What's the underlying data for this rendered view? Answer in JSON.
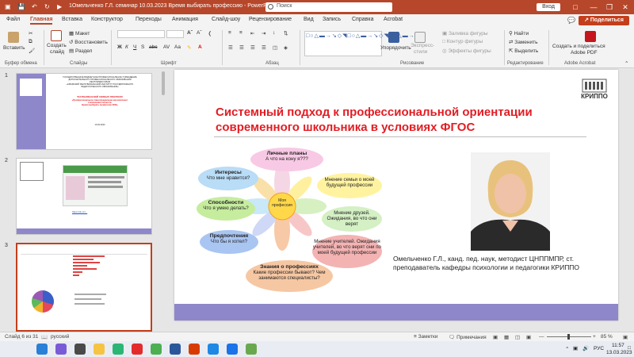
{
  "titlebar": {
    "doc_title": "1Омельченко Г.Л. семинар 10.03.2023 Время выбирать профессию  -  PowerPoint",
    "search": "Поиск",
    "signin": "Вход"
  },
  "tabs": [
    "Файл",
    "Главная",
    "Вставка",
    "Конструктор",
    "Переходы",
    "Анимация",
    "Слайд-шоу",
    "Рецензирование",
    "Вид",
    "Запись",
    "Справка",
    "Acrobat"
  ],
  "share": "Поделиться",
  "ribbon": {
    "paste": "Вставить",
    "create_slide_line1": "Создать",
    "create_slide_line2": "слайд",
    "layout": "Макет",
    "reset": "Восстановить",
    "section": "Раздел",
    "shape_fill": "Заливка фигуры",
    "shape_outline": "Контур фигуры",
    "shape_effects": "Эффекты фигуры",
    "arrange": "Упорядочить",
    "express_styles_line1": "Экспресс-",
    "express_styles_line2": "стили",
    "find": "Найти",
    "replace": "Заменить",
    "select": "Выделить",
    "create_pdf_line1": "Создать и поделиться",
    "create_pdf_line2": "Adobe PDF",
    "groups": {
      "clipboard": "Буфер обмена",
      "slides": "Слайды",
      "font": "Шрифт",
      "paragraph": "Абзац",
      "drawing": "Рисование",
      "editing": "Редактирование",
      "acrobat": "Adobe Acrobat"
    }
  },
  "thumbnails": [
    {
      "num": "1",
      "lines": [
        "ГОСУДАРСТВЕННОЕ БЮДЖЕТНОЕ ПРОФЕССИОНАЛЬНОЕ УЧРЕЖДЕНИЕ",
        "ДОПОЛНИТЕЛЬНОГО ПРОФЕССИОНАЛЬНОГО ОБРАЗОВАНИЯ",
        "РЕСПУБЛИКИ КРЫМ",
        "«КРЫМСКИЙ РЕСПУБЛИКАНСКИЙ ИНСТИТУТ ПОСТДИПЛОМНОГО",
        "ПЕДАГОГИЧЕСКОГО ОБРАЗОВАНИЯ»"
      ],
      "red_lines": [
        "РЕСПУБЛИКАНСКИЙ СЕМИНАР-ПРАКТИКУМ",
        "«Профессиональное самоопределение как компонент",
        "становления личности.",
        "Время выбирать профессию 2023»"
      ],
      "date": "10.03.2023"
    },
    {
      "num": "2",
      "link": "https://vk.cc/..."
    },
    {
      "num": "3"
    }
  ],
  "slide": {
    "title": "Системный подход к профессиональной ориентации современного школьника в условиях ФГОС",
    "logo_text": "КРИППО",
    "caption": "Омельченко Г.Л., канд. пед. наук, методист ЦНППМПР, ст. преподаватель кафедры психологии и педагогики КРИППО",
    "diagram": {
      "center": "Моя профессия",
      "nodes": [
        {
          "title": "Личные планы",
          "sub": "А что на кону я???"
        },
        {
          "title": "Интересы",
          "sub": "Что мне нравится?"
        },
        {
          "title": "Способности",
          "sub": "Что я умею делать?"
        },
        {
          "title": "Предпочтения",
          "sub": "Что бы я хотел?"
        },
        {
          "title": "Знания о профессиях",
          "sub": "Какие профессии бывают? Чем занимаются специалисты?"
        },
        {
          "title": "Мнение семьи",
          "sub": "Мнение семьи о моей будущей профессии"
        },
        {
          "title": "Мнение друзей",
          "sub": "Мнение друзей. Ожидания, во что они верят"
        },
        {
          "title": "Мнение учителей",
          "sub": "Мнение учителей. Ожидания учителей, во что верят они по моей будущей профессии"
        }
      ]
    }
  },
  "status": {
    "slide_counter": "Слайд 6 из 31",
    "language": "русский",
    "notes": "Заметки",
    "comments": "Примечания",
    "zoom": "85 %"
  },
  "taskbar": {
    "time": "11:57",
    "date": "13.03.2023",
    "lang": "РУС"
  },
  "colors": {
    "accent": "#b7472a",
    "title_red": "#e21d24",
    "bar_purple": "#8e87c9"
  }
}
